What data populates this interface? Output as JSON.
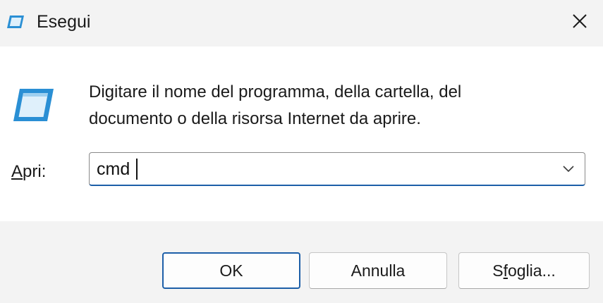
{
  "window": {
    "title": "Esegui"
  },
  "icons": {
    "app": "run-icon",
    "close": "close-icon",
    "dropdown": "chevron-down-icon"
  },
  "content": {
    "description_line1": "Digitare il nome del programma, della cartella, del",
    "description_line2": "documento o della risorsa Internet da aprire."
  },
  "open_field": {
    "label_accel": "A",
    "label_rest": "pri:",
    "value": "cmd"
  },
  "buttons": {
    "ok": "OK",
    "cancel": "Annulla",
    "browse_pre": "S",
    "browse_accel": "f",
    "browse_post": "oglia..."
  },
  "colors": {
    "accent": "#1d5fa8",
    "icon_blue": "#2a8fd4",
    "titlebar_bg": "#f3f3f3",
    "content_bg": "#ffffff"
  }
}
